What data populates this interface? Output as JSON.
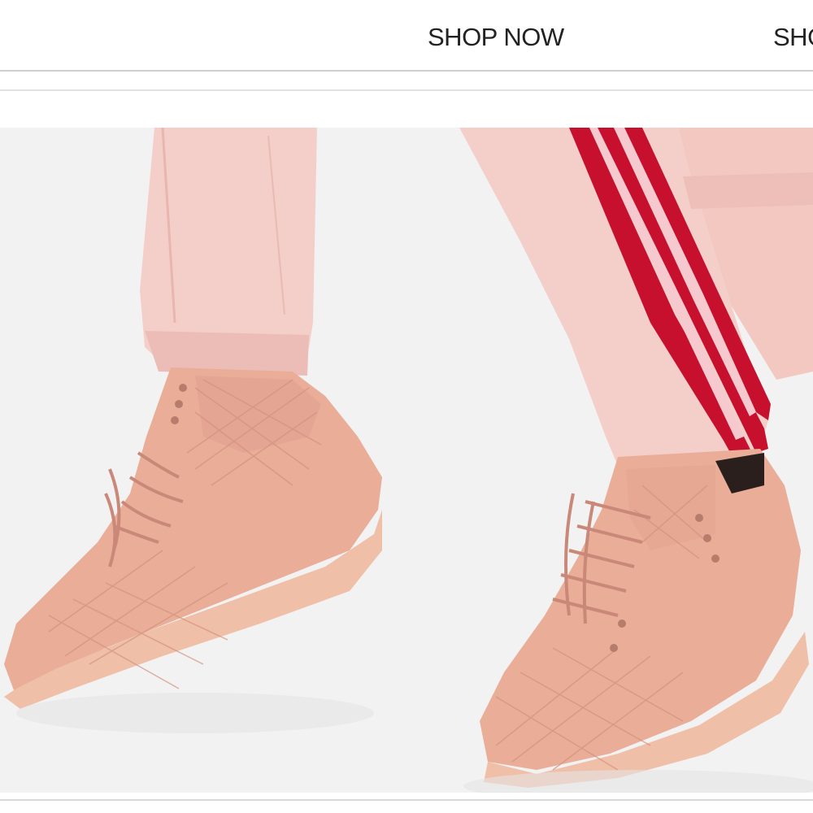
{
  "nav": {
    "shop_now_label": "SHOP NOW",
    "shop_clipped_label": "SHOP NOW"
  },
  "hero": {
    "icon": "product-photo",
    "colors": {
      "background": "#f1f1f1",
      "pants": "#f4cfc9",
      "stripe": "#c7102e",
      "sneaker": "#e9ad98",
      "sole": "#f0bfa8"
    }
  }
}
